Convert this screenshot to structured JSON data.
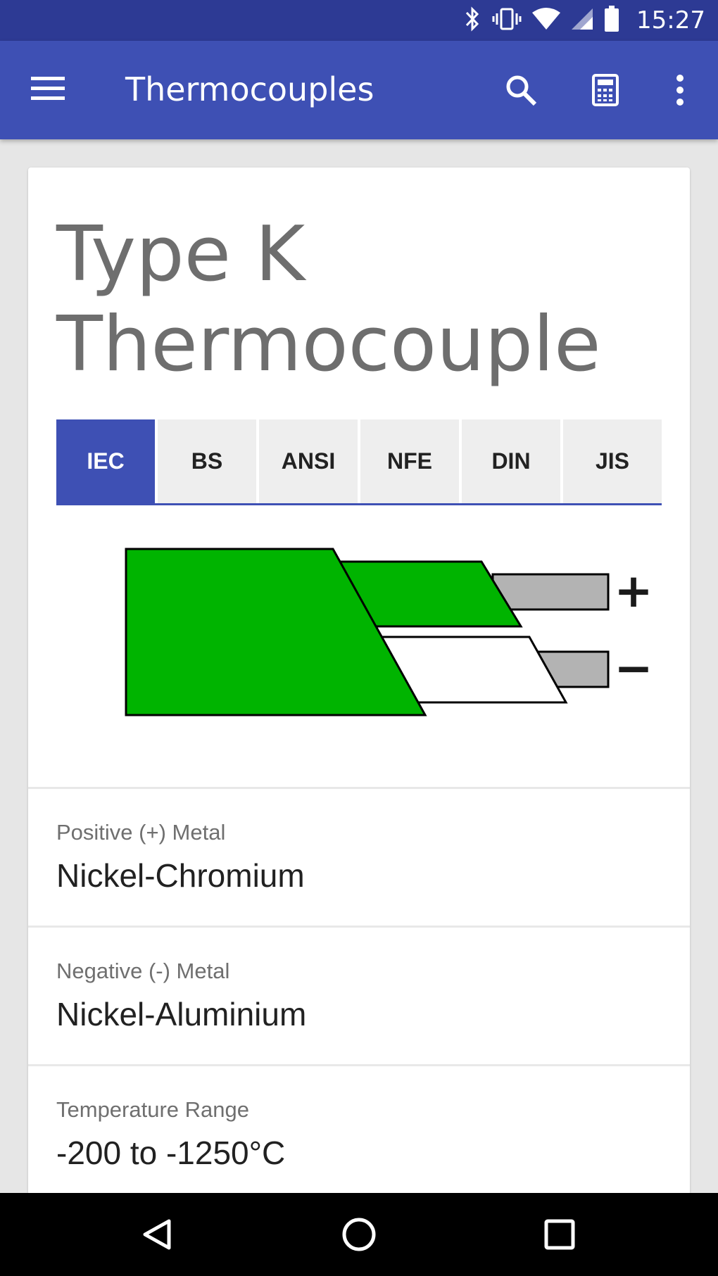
{
  "status_bar": {
    "time": "15:27",
    "icons": [
      "bluetooth-icon",
      "vibrate-icon",
      "wifi-icon",
      "signal-icon",
      "battery-icon"
    ]
  },
  "app_bar": {
    "title": "Thermocouples",
    "actions": [
      "search-icon",
      "calculator-icon",
      "more-vert-icon"
    ],
    "color": "#3e50b4"
  },
  "card": {
    "heading": "Type K Thermocouple",
    "tabs": [
      {
        "label": "IEC",
        "active": true
      },
      {
        "label": "BS",
        "active": false
      },
      {
        "label": "ANSI",
        "active": false
      },
      {
        "label": "NFE",
        "active": false
      },
      {
        "label": "DIN",
        "active": false
      },
      {
        "label": "JIS",
        "active": false
      }
    ],
    "diagram": {
      "outer_sheath_color": "#00b400",
      "positive_wire_color": "#00b400",
      "negative_wire_color": "#ffffff",
      "conductor_color": "#b3b3b3",
      "positive_sign": "+",
      "negative_sign": "−"
    },
    "rows": [
      {
        "label": "Positive (+) Metal",
        "value": "Nickel-Chromium"
      },
      {
        "label": "Negative (-) Metal",
        "value": "Nickel-Aluminium"
      },
      {
        "label": "Temperature Range",
        "value": "-200 to -1250°C"
      }
    ]
  },
  "nav_bar": {
    "buttons": [
      "back-icon",
      "home-icon",
      "recents-icon"
    ]
  }
}
